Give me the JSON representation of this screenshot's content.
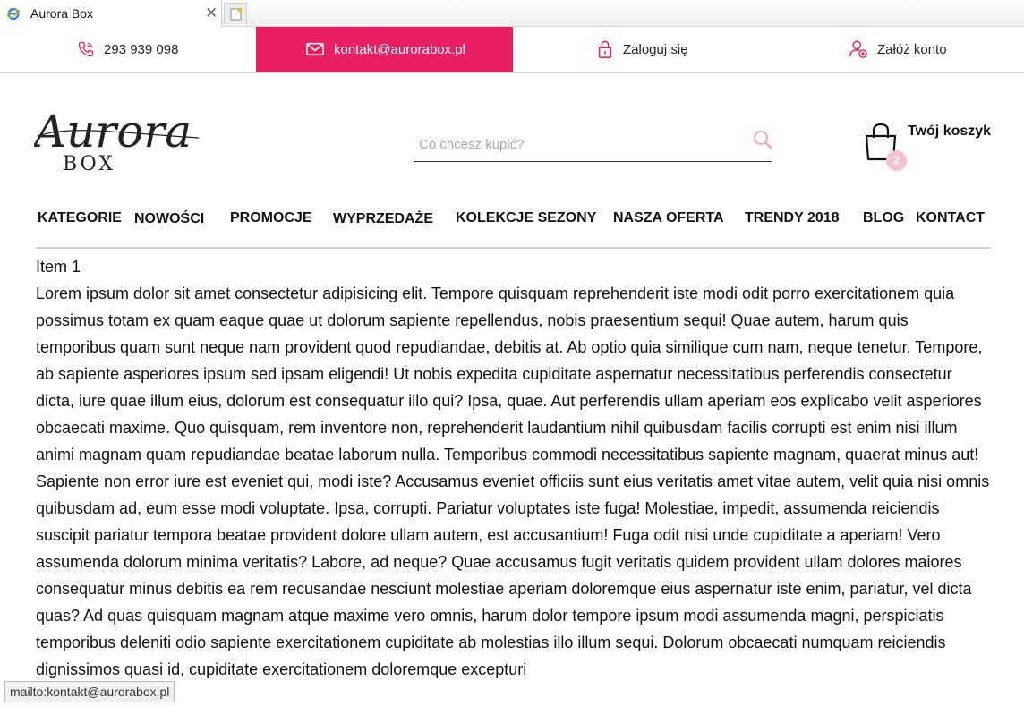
{
  "browser": {
    "tab_title": "Aurora Box"
  },
  "topbar": {
    "phone": "293 939 098",
    "email": "kontakt@aurorabox.pl",
    "login": "Zaloguj się",
    "register": "Załóż konto",
    "accent_color": "#e91e63"
  },
  "header": {
    "logo_text": "Aurora",
    "logo_subtext": "BOX",
    "search_placeholder": "Co chcesz kupić?",
    "cart_label": "Twój koszyk",
    "cart_count": "2"
  },
  "nav": {
    "items": [
      "KATEGORIE",
      "NOWOŚCI",
      "PROMOCJE",
      "WYPRZEDAŻE",
      "KOLEKCJE SEZONY",
      "NASZA OFERTA",
      "TRENDY 2018",
      "BLOG",
      "KONTACT"
    ]
  },
  "content": {
    "item_title": "Item 1",
    "body": "Lorem ipsum dolor sit amet consectetur adipisicing elit. Tempore quisquam reprehenderit iste modi odit porro exercitationem quia possimus totam ex quam eaque quae ut dolorum sapiente repellendus, nobis praesentium sequi! Quae autem, harum quis temporibus quam sunt neque nam provident quod repudiandae, debitis at. Ab optio quia similique cum nam, neque tenetur. Tempore, ab sapiente asperiores ipsum sed ipsam eligendi! Ut nobis expedita cupiditate aspernatur necessitatibus perferendis consectetur dicta, iure quae illum eius, dolorum est consequatur illo qui? Ipsa, quae. Aut perferendis ullam aperiam eos explicabo velit asperiores obcaecati maxime. Quo quisquam, rem inventore non, reprehenderit laudantium nihil quibusdam facilis corrupti est enim nisi illum animi magnam quam repudiandae beatae laborum nulla. Temporibus commodi necessitatibus sapiente magnam, quaerat minus aut! Sapiente non error iure est eveniet qui, modi iste? Accusamus eveniet officiis sunt eius veritatis amet vitae autem, velit quia nisi omnis quibusdam ad, eum esse modi voluptate. Ipsa, corrupti. Pariatur voluptates iste fuga! Molestiae, impedit, assumenda reiciendis suscipit pariatur tempora beatae provident dolore ullam autem, est accusantium! Fuga odit nisi unde cupiditate a aperiam! Vero assumenda dolorum minima veritatis? Labore, ad neque? Quae accusamus fugit veritatis quidem provident ullam dolores maiores consequatur minus debitis ea rem recusandae nesciunt molestiae aperiam doloremque eius aspernatur iste enim, pariatur, vel dicta quas? Ad quas quisquam magnam atque maxime vero omnis, harum dolor tempore ipsum modi assumenda magni, perspiciatis temporibus deleniti odio sapiente exercitationem cupiditate ab molestias illo illum sequi. Dolorum obcaecati numquam reiciendis dignissimos quasi id, cupiditate exercitationem doloremque excepturi"
  },
  "statusbar": {
    "text": "mailto:kontakt@aurorabox.pl"
  }
}
